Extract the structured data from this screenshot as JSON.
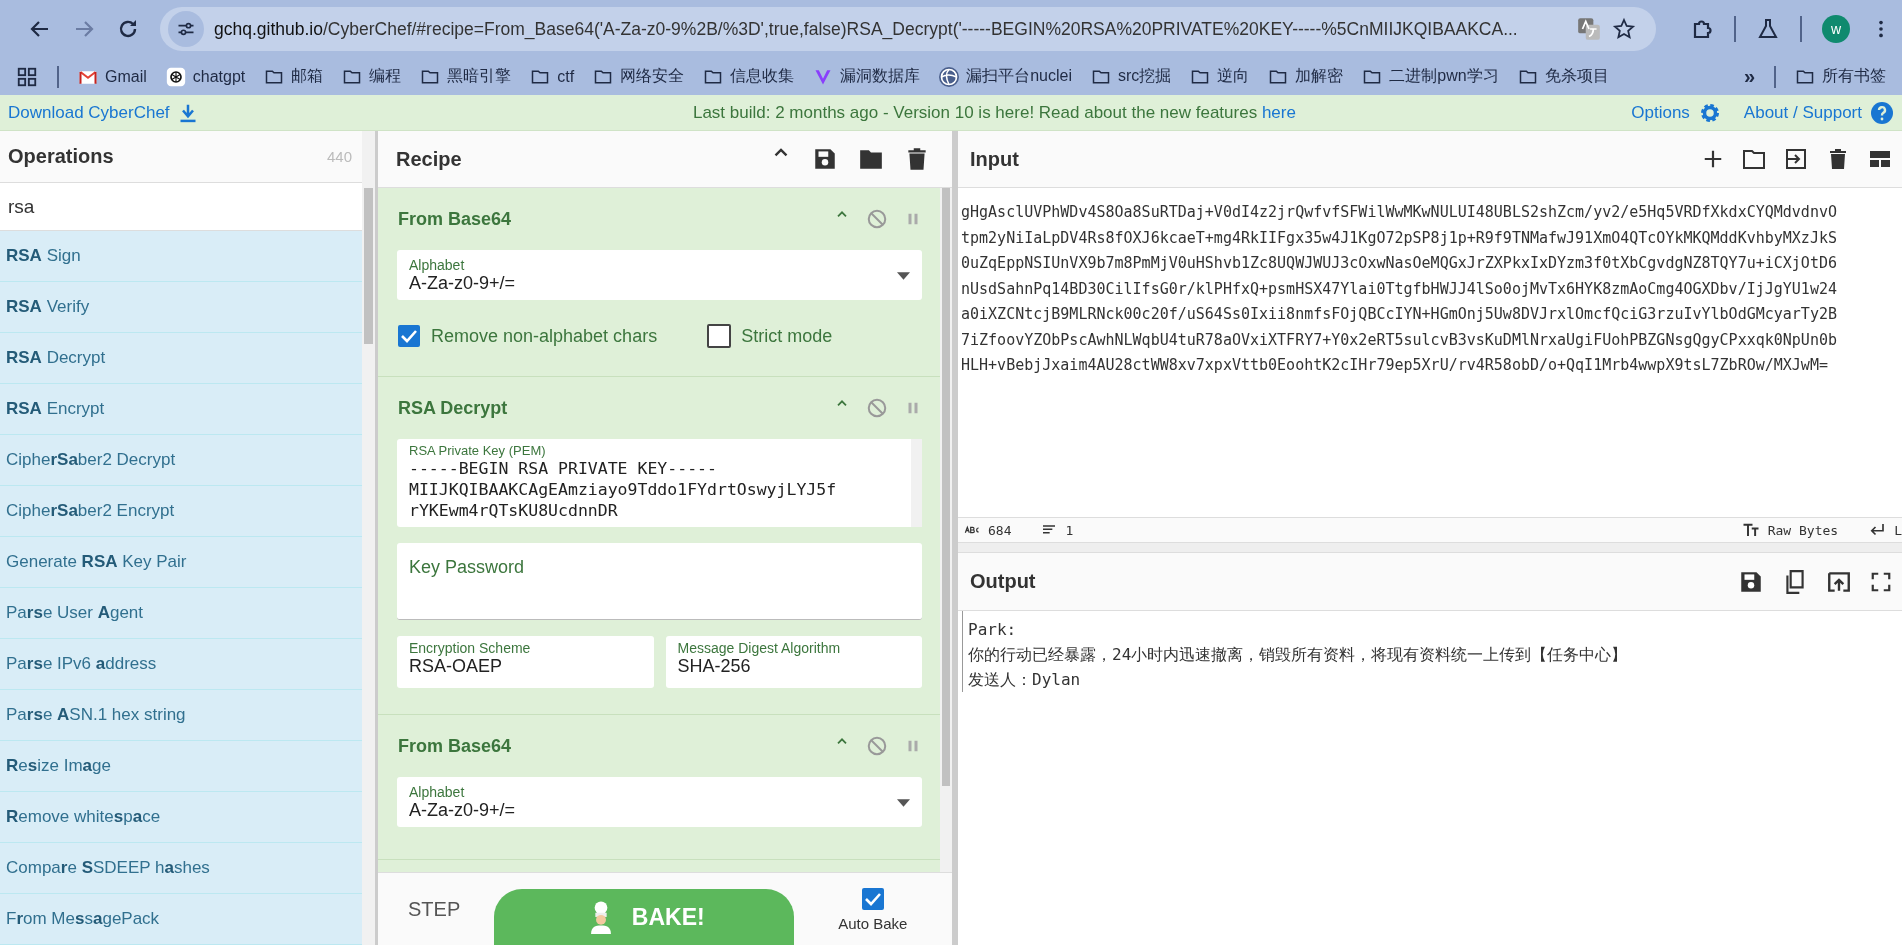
{
  "browser": {
    "url_host": "gchq.github.io",
    "url_path": "/CyberChef/#recipe=From_Base64('A-Za-z0-9%2B/%3D',true,false)RSA_Decrypt('-----BEGIN%20RSA%20PRIVATE%20KEY-----%5CnMIIJKQIBAAKCA...",
    "profile_initial": "w",
    "bookmarks": [
      {
        "label": "Gmail",
        "kind": "gmail"
      },
      {
        "label": "chatgpt",
        "kind": "chatgpt"
      },
      {
        "label": "邮箱",
        "kind": "folder"
      },
      {
        "label": "编程",
        "kind": "folder"
      },
      {
        "label": "黑暗引擎",
        "kind": "folder"
      },
      {
        "label": "ctf",
        "kind": "folder"
      },
      {
        "label": "网络安全",
        "kind": "folder"
      },
      {
        "label": "信息收集",
        "kind": "folder"
      },
      {
        "label": "漏洞数据库",
        "kind": "vulndb"
      },
      {
        "label": "漏扫平台nuclei",
        "kind": "nuclei"
      },
      {
        "label": "src挖掘",
        "kind": "folder"
      },
      {
        "label": "逆向",
        "kind": "folder"
      },
      {
        "label": "加解密",
        "kind": "folder"
      },
      {
        "label": "二进制pwn学习",
        "kind": "folder"
      },
      {
        "label": "免杀项目",
        "kind": "folder"
      }
    ],
    "overflow": "»",
    "all_bookmarks": "所有书签"
  },
  "banner": {
    "download": "Download CyberChef",
    "build_text": "Last build: 2 months ago - Version 10 is here! Read about the new features",
    "build_link": "here",
    "options": "Options",
    "about": "About / Support"
  },
  "operations": {
    "title": "Operations",
    "count": "440",
    "search_value": "rsa",
    "items": [
      {
        "label": "**RSA** Sign"
      },
      {
        "label": "**RSA** Verify"
      },
      {
        "label": "**RSA** Decrypt"
      },
      {
        "label": "**RSA** Encrypt"
      },
      {
        "label": "Ciphe**rSa**ber2 Decrypt"
      },
      {
        "label": "Ciphe**rSa**ber2 Encrypt"
      },
      {
        "label": "Generate **RSA** Key Pair"
      },
      {
        "label": "Pa**rs**e User **A**gent"
      },
      {
        "label": "Pa**rs**e IPv6 **a**ddress"
      },
      {
        "label": "Pa**rs**e **A**SN.1 hex string"
      },
      {
        "label": "**R**e**s**ize Im**a**ge"
      },
      {
        "label": "**R**emove white**s**p**a**ce"
      },
      {
        "label": "Compa**r**e **S**SDEEP h**a**shes"
      },
      {
        "label": "F**r**om Me**s**s**a**gePack"
      }
    ]
  },
  "recipe": {
    "title": "Recipe",
    "steps": [
      {
        "title": "From Base64",
        "fields": [
          {
            "kind": "dropdown",
            "label": "Alphabet",
            "value": "A-Za-z0-9+/="
          },
          {
            "kind": "checkboxes",
            "items": [
              {
                "label": "Remove non-alphabet chars",
                "checked": true
              },
              {
                "label": "Strict mode",
                "checked": false
              }
            ]
          }
        ]
      },
      {
        "title": "RSA Decrypt",
        "fields": [
          {
            "kind": "textarea",
            "label": "RSA Private Key (PEM)",
            "lines": [
              "-----BEGIN RSA PRIVATE KEY-----",
              "MIIJKQIBAAKCAgEAmziayo9Tddo1FYdrtOswyjLYJ5f",
              "rYKEwm4rQTsKU8UcdnnDR"
            ]
          },
          {
            "kind": "password",
            "label": "Key Password"
          },
          {
            "kind": "row",
            "fields": [
              {
                "label": "Encryption Scheme",
                "value": "RSA-OAEP"
              },
              {
                "label": "Message Digest Algorithm",
                "value": "SHA-256"
              }
            ]
          }
        ]
      },
      {
        "title": "From Base64",
        "fields": [
          {
            "kind": "dropdown",
            "label": "Alphabet",
            "value": "A-Za-z0-9+/="
          }
        ]
      }
    ],
    "step_button": "STEP",
    "bake_button": "BAKE!",
    "auto_bake": {
      "label": "Auto Bake",
      "checked": true
    }
  },
  "input": {
    "title": "Input",
    "lines": [
      "gHgAsclUVPhWDv4S8Oa8SuRTDaj+V0dI4z2jrQwfvfSFWilWwMKwNULUI48UBLS2shZcm/yv2/e5Hq5VRDfXkdxCYQMdvdnvO",
      "tpm2yNiIaLpDV4Rs8fOXJ6kcaeT+mg4RkIIFgx35w4J1KgO72pSP8j1p+R9f9TNMafwJ91XmO4QTcOYkMKQMddKvhbyMXzJkS",
      "0uZqEppNSIUnVX9b7m8PmMjV0uHShvb1Zc8UQWJWUJ3cOxwNasOeMQGxJrZXPkxIxDYzm3f0tXbCgvdgNZ8TQY7u+iCXjOtD6",
      "nUsdSahnPq14BD30CilIfsG0r/klPHfxQ+psmHSX47Ylai0TtgfbHWJJ4lSo0ojMvTx6HYK8zmAoCmg4OGXDbv/IjJgYU1w24",
      "a0iXZCNtcjB9MLRNck00c20f/uS64Ss0Ixii8nmfsFOjQBCcIYN+HGmOnj5Uw8DVJrxlOmcfQciG3rzuIvYlbOdGMcyarTy2B",
      "7iZfoovYZObPscAwhNLWqbU4tuR78aOVxiXTFRY7+Y0x2eRT5sulcvB3vsKuDMlNrxaUgiFUohPBZGNsgQgyCPxxqk0NpUn0b",
      "HLH+vBebjJxaim4AU28ctWW8xv7xpxVttb0EoohtK2cIHr79ep5XrU/rv4R58obD/o+QqI1Mrb4wwpX9tsL7ZbROw/MXJwM="
    ],
    "length": "684",
    "line_count": "1",
    "raw_bytes": "Raw Bytes",
    "eol": "L"
  },
  "output": {
    "title": "Output",
    "lines": [
      "Park:",
      "你的行动已经暴露，24小时内迅速撤离，销毁所有资料，将现有资料统一上传到【任务中心】",
      "发送人：Dylan"
    ]
  }
}
